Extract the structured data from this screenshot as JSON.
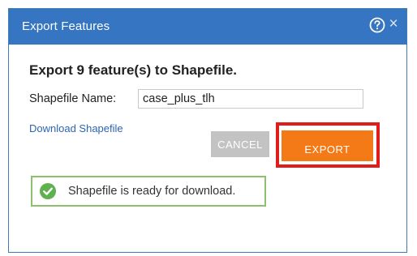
{
  "dialog": {
    "title": "Export Features",
    "heading": "Export 9 feature(s) to Shapefile.",
    "field_label": "Shapefile Name:",
    "field_value": "case_plus_tlh",
    "download_link": "Download Shapefile",
    "cancel_label": "CANCEL",
    "export_label": "EXPORT",
    "status_text": "Shapefile is ready for download.",
    "close_glyph": "×"
  },
  "icons": {
    "help": "help-icon",
    "close": "close-icon",
    "status": "check-circle-icon"
  },
  "colors": {
    "titlebar": "#3575c1",
    "export_button": "#f47a17",
    "cancel_button": "#c3c3c3",
    "highlight": "#e21b1b",
    "status_border": "#8dc06b",
    "link": "#2c64b5"
  }
}
